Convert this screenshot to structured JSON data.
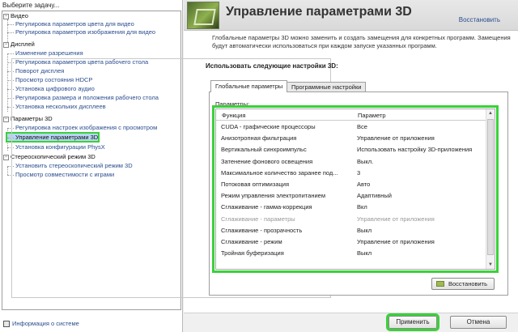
{
  "left_panel": {
    "title": "Выберите задачу...",
    "tree": [
      {
        "label": "Видео",
        "type": "category"
      },
      {
        "label": "Регулировка параметров цвета для видео",
        "type": "item"
      },
      {
        "label": "Регулировка параметров изображения для видео",
        "type": "item"
      },
      {
        "label": "Дисплей",
        "type": "category"
      },
      {
        "label": "Изменение разрешения",
        "type": "item"
      },
      {
        "label": "Регулировка параметров цвета рабочего стола",
        "type": "item"
      },
      {
        "label": "Поворот дисплея",
        "type": "item"
      },
      {
        "label": "Просмотр состояния HDCP",
        "type": "item"
      },
      {
        "label": "Установка цифрового аудио",
        "type": "item"
      },
      {
        "label": "Регулировка размера и положения рабочего стола",
        "type": "item"
      },
      {
        "label": "Установка нескольких дисплеев",
        "type": "item"
      },
      {
        "label": "Параметры 3D",
        "type": "category"
      },
      {
        "label": "Регулировка настроек изображения с просмотром",
        "type": "item"
      },
      {
        "label": "Управление параметрами 3D",
        "type": "item",
        "selected": true
      },
      {
        "label": "Установка конфигурации PhysX",
        "type": "item"
      },
      {
        "label": "Стереоскопический режим 3D",
        "type": "category"
      },
      {
        "label": "Установить стереоскопический режим 3D",
        "type": "item"
      },
      {
        "label": "Просмотр совместимости с играми",
        "type": "item"
      }
    ],
    "system_info_link": "Информация о системе"
  },
  "header": {
    "title": "Управление параметрами 3D",
    "restore_link": "Восстановить",
    "description": "Глобальные параметры 3D можно заменить и создать замещения для конкретных программ. Замещения будут автоматически использоваться при каждом запуске указанных программ."
  },
  "settings": {
    "group_title": "Использовать следующие настройки 3D:",
    "tabs": [
      "Глобальные параметры",
      "Программные настройки"
    ],
    "active_tab": 0,
    "params_label": "Параметры:",
    "columns": [
      "Функция",
      "Параметр"
    ],
    "rows": [
      {
        "function": "CUDA - графические процессоры",
        "value": "Все",
        "disabled": false
      },
      {
        "function": "Анизотропная фильтрация",
        "value": "Управление от приложения",
        "disabled": false
      },
      {
        "function": "Вертикальный синхроимпульс",
        "value": "Использовать настройку 3D-приложения",
        "disabled": false
      },
      {
        "function": "Затенение фонового освещения",
        "value": "Выкл.",
        "disabled": false
      },
      {
        "function": "Максимальное количество заранее под...",
        "value": "3",
        "disabled": false
      },
      {
        "function": "Потоковая оптимизация",
        "value": "Авто",
        "disabled": false
      },
      {
        "function": "Режим управления электропитанием",
        "value": "Адаптивный",
        "disabled": false
      },
      {
        "function": "Сглаживание - гамма-коррекция",
        "value": "Вкл",
        "disabled": false
      },
      {
        "function": "Сглаживание - параметры",
        "value": "Управление от приложения",
        "disabled": true
      },
      {
        "function": "Сглаживание - прозрачность",
        "value": "Выкл",
        "disabled": false
      },
      {
        "function": "Сглаживание - режим",
        "value": "Управление от приложения",
        "disabled": false
      },
      {
        "function": "Тройная буферизация",
        "value": "Выкл",
        "disabled": false
      }
    ],
    "restore_button": "Восстановить"
  },
  "footer": {
    "apply_button": "Применить",
    "cancel_button": "Отмена"
  },
  "colors": {
    "highlight_outline": "#3ad13a",
    "link": "#2a4d8f"
  },
  "icons": {
    "banner": "nvidia-3d-settings-icon",
    "system_info": "system-info-icon",
    "restore": "restore-defaults-icon"
  }
}
